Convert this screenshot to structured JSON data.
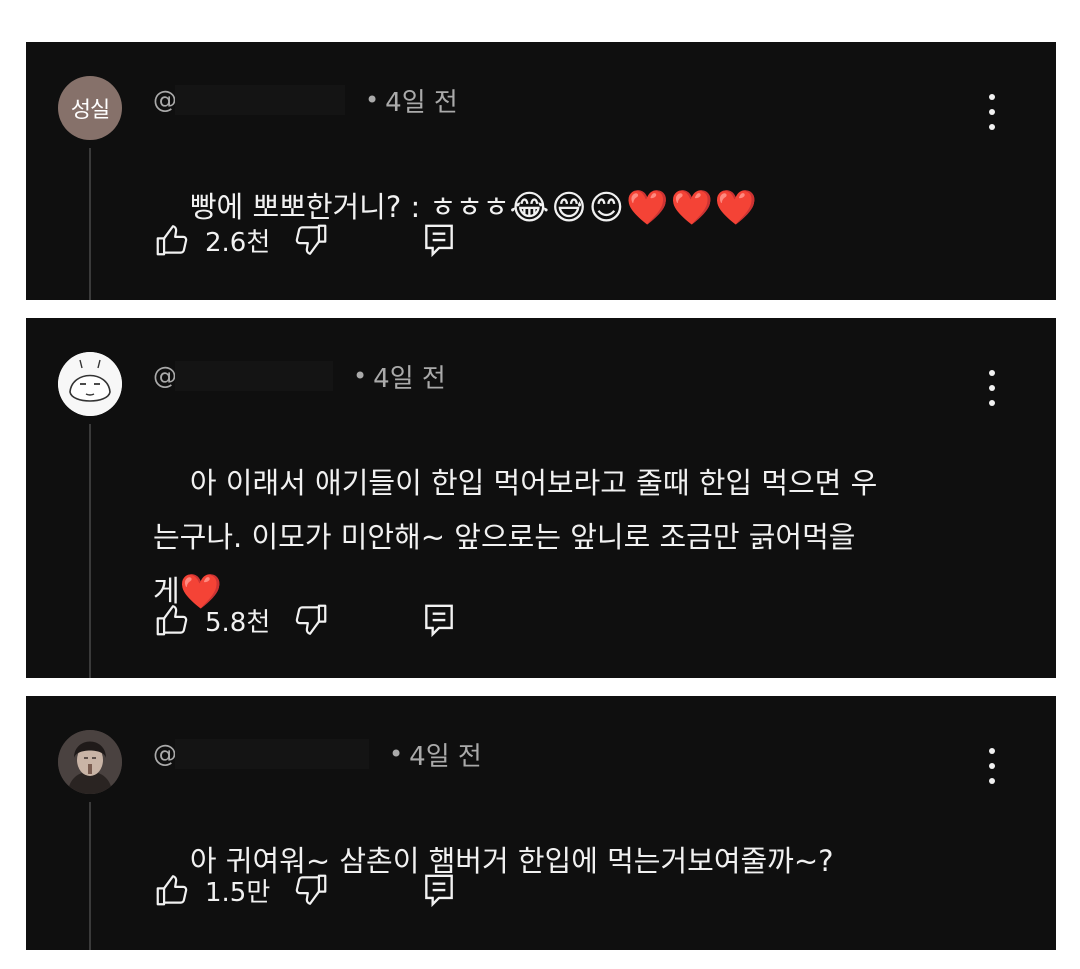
{
  "comments": [
    {
      "avatar_text": "성실",
      "handle": "@",
      "separator": "•",
      "time": "4일 전",
      "text": "빵에 뽀뽀한거니? : ㅎㅎㅎ",
      "emojis": "😂😅😊❤️❤️❤️",
      "likes": "2.6천"
    },
    {
      "avatar_text": "",
      "handle": "@",
      "separator": "•",
      "time": "4일 전",
      "text": "아 이래서 애기들이 한입 먹어보라고 줄때 한입 먹으면 우\n는구나. 이모가 미안해~ 앞으로는 앞니로 조금만 긁어먹을\n게",
      "emojis": "❤️",
      "likes": "5.8천"
    },
    {
      "avatar_text": "",
      "handle": "@",
      "separator": "•",
      "time": "4일 전",
      "text": "아 귀여워~ 삼촌이 햄버거 한입에 먹는거보여줄까~?",
      "emojis": "",
      "likes": "1.5만"
    }
  ],
  "icons": {
    "like": "thumbs-up-icon",
    "dislike": "thumbs-down-icon",
    "reply": "reply-comment-icon",
    "more": "more-vert-icon"
  },
  "colors": {
    "card_background": "#0f0f0f",
    "page_background": "#ffffff",
    "text_primary": "#f1f1f1",
    "text_secondary": "#aaaaaa",
    "avatar_1": "#86716a"
  }
}
